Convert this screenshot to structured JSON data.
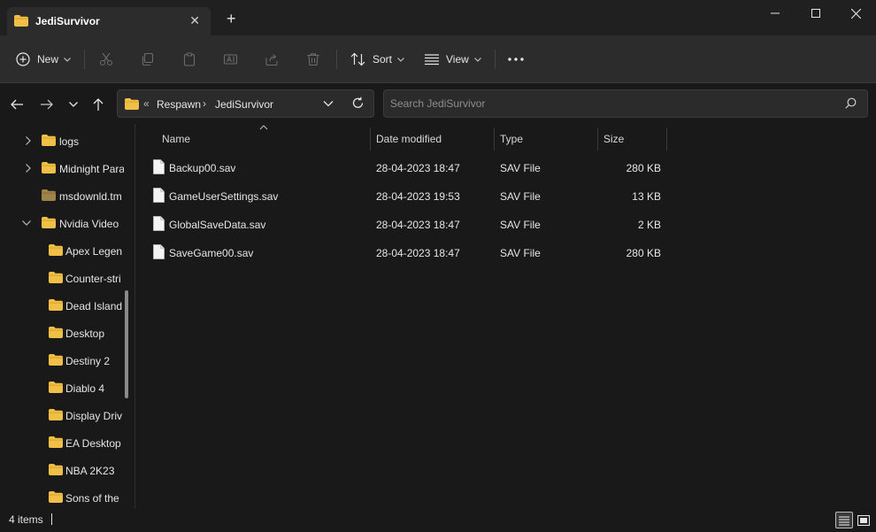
{
  "window": {
    "tab_title": "JediSurvivor",
    "new_tab_label": "+"
  },
  "toolbar": {
    "new_label": "New",
    "sort_label": "Sort",
    "view_label": "View",
    "more_label": "•••"
  },
  "address": {
    "overflow": "«",
    "crumbs": [
      "Respawn",
      "JediSurvivor"
    ],
    "separator": "›"
  },
  "search": {
    "placeholder": "Search JediSurvivor"
  },
  "sidebar": {
    "items": [
      {
        "label": "logs",
        "expandable": "collapsed"
      },
      {
        "label": "Midnight Para",
        "expandable": "collapsed"
      },
      {
        "label": "msdownld.tm",
        "expandable": "none"
      },
      {
        "label": "Nvidia Video",
        "expandable": "expanded"
      },
      {
        "label": "Apex Legen",
        "expandable": "none"
      },
      {
        "label": "Counter-stri",
        "expandable": "none"
      },
      {
        "label": "Dead Island",
        "expandable": "none"
      },
      {
        "label": "Desktop",
        "expandable": "none"
      },
      {
        "label": "Destiny 2",
        "expandable": "none"
      },
      {
        "label": "Diablo 4",
        "expandable": "none"
      },
      {
        "label": "Display Driv",
        "expandable": "none"
      },
      {
        "label": "EA Desktop",
        "expandable": "none"
      },
      {
        "label": "NBA 2K23",
        "expandable": "none"
      },
      {
        "label": "Sons of the",
        "expandable": "none"
      }
    ]
  },
  "files": {
    "columns": [
      "Name",
      "Date modified",
      "Type",
      "Size"
    ],
    "rows": [
      {
        "name": "Backup00.sav",
        "date": "28-04-2023 18:47",
        "type": "SAV File",
        "size": "280 KB"
      },
      {
        "name": "GameUserSettings.sav",
        "date": "28-04-2023 19:53",
        "type": "SAV File",
        "size": "13 KB"
      },
      {
        "name": "GlobalSaveData.sav",
        "date": "28-04-2023 18:47",
        "type": "SAV File",
        "size": "2 KB"
      },
      {
        "name": "SaveGame00.sav",
        "date": "28-04-2023 18:47",
        "type": "SAV File",
        "size": "280 KB"
      }
    ]
  },
  "status": {
    "item_count": "4 items"
  },
  "colors": {
    "folder": "#f0c046",
    "background": "#191919",
    "toolbar": "#2c2c2c"
  }
}
